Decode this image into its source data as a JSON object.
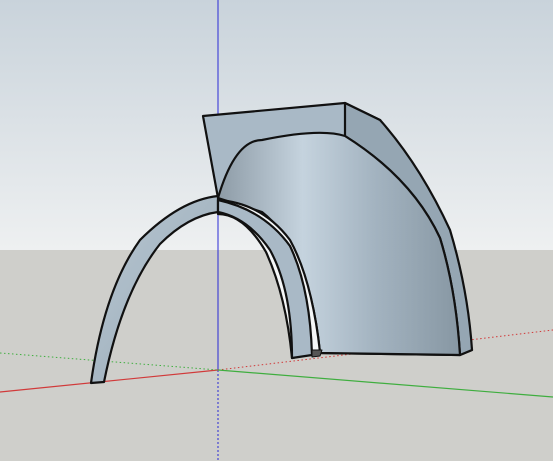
{
  "colors": {
    "sky_top": "#c9d3db",
    "sky_bottom": "#eef0f1",
    "ground": "#cfcfcb",
    "axis_red": "#d13a3a",
    "axis_green": "#3fae3f",
    "axis_blue": "#2a2ad6",
    "model_face": "#a9b9c6",
    "model_face_light": "#c6d4de",
    "model_face_dark": "#7d8c97",
    "edge": "#111111"
  },
  "scene": {
    "model": "arched-wall",
    "axes": [
      "red-axis",
      "green-axis",
      "blue-axis"
    ]
  }
}
